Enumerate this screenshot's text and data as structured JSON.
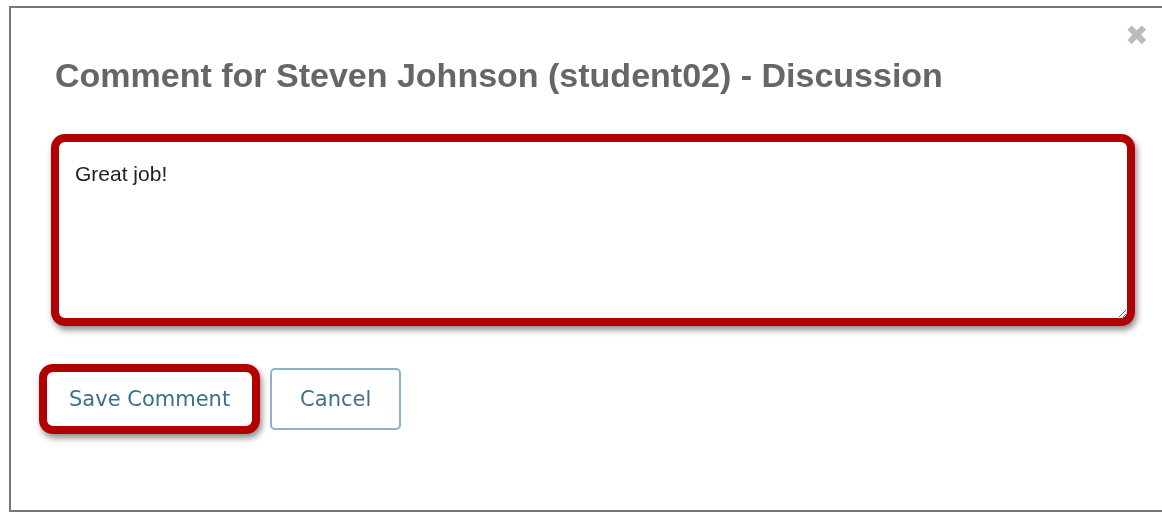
{
  "dialog": {
    "title": "Comment for Steven Johnson (student02) - Discussion",
    "close": "✖"
  },
  "comment": {
    "value": "Great job!",
    "highlighted": true
  },
  "buttons": [
    {
      "label": "Save Comment",
      "highlighted": true
    },
    {
      "label": "Cancel",
      "highlighted": false
    }
  ]
}
